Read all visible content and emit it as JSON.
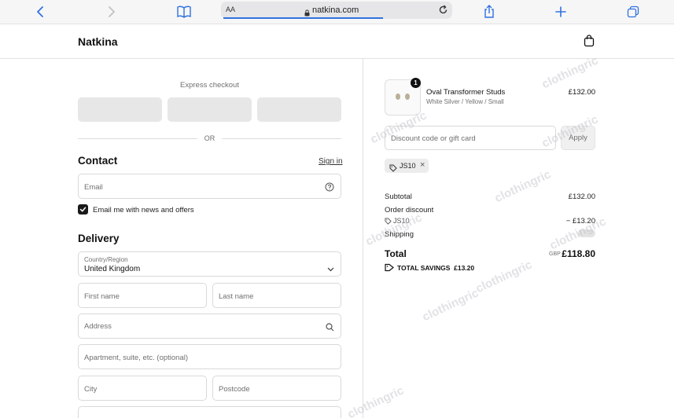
{
  "browser": {
    "text_size_label": "AA",
    "url": "natkina.com"
  },
  "shop": {
    "brand": "Natkina"
  },
  "checkout": {
    "express_label": "Express checkout",
    "or_label": "OR",
    "contact": {
      "title": "Contact",
      "signin_label": "Sign in",
      "email_placeholder": "Email",
      "newsletter_label": "Email me with news and offers",
      "newsletter_checked": true
    },
    "delivery": {
      "title": "Delivery",
      "country_label": "Country/Region",
      "country_value": "United Kingdom",
      "first_name_placeholder": "First name",
      "last_name_placeholder": "Last name",
      "address_placeholder": "Address",
      "apartment_placeholder": "Apartment, suite, etc. (optional)",
      "city_placeholder": "City",
      "postcode_placeholder": "Postcode"
    }
  },
  "order": {
    "item": {
      "quantity": "1",
      "name": "Oval Transformer Studs",
      "variant": "White Silver / Yellow / Small",
      "price": "£132.00"
    },
    "discount_placeholder": "Discount code or gift card",
    "apply_label": "Apply",
    "applied_code": "JS10",
    "remove_code_icon": "×",
    "subtotal_label": "Subtotal",
    "subtotal_value": "£132.00",
    "order_discount_label": "Order discount",
    "discount_code": "JS10",
    "discount_value": "− £13.20",
    "shipping_label": "Shipping",
    "total_label": "Total",
    "total_currency": "GBP",
    "total_value": "£118.80",
    "savings_label": "TOTAL SAVINGS",
    "savings_value": "£13.20"
  },
  "watermark": "clothingric"
}
